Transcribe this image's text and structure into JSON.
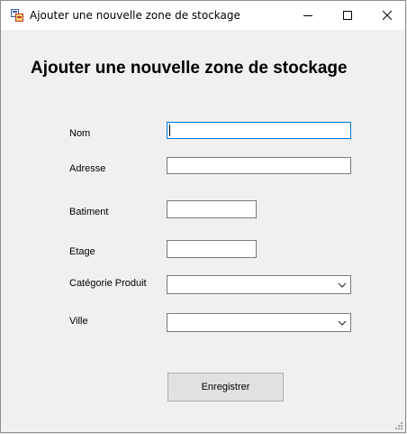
{
  "window": {
    "title": "Ajouter une nouvelle zone de stockage",
    "controls": {
      "minimize_icon": "minimize-icon",
      "maximize_icon": "maximize-icon",
      "close_icon": "close-icon"
    }
  },
  "form": {
    "heading": "Ajouter une nouvelle zone de stockage",
    "fields": {
      "nom": {
        "label": "Nom",
        "value": ""
      },
      "adresse": {
        "label": "Adresse",
        "value": ""
      },
      "batiment": {
        "label": "Batiment",
        "value": ""
      },
      "etage": {
        "label": "Etage",
        "value": ""
      },
      "categorie": {
        "label": "Catégorie Produit",
        "selected": ""
      },
      "ville": {
        "label": "Ville",
        "selected": ""
      }
    },
    "submit_label": "Enregistrer"
  },
  "colors": {
    "background": "#f0f0f0",
    "titlebar": "#ffffff",
    "focus_border": "#0078d7",
    "button_face": "#e1e1e1"
  }
}
